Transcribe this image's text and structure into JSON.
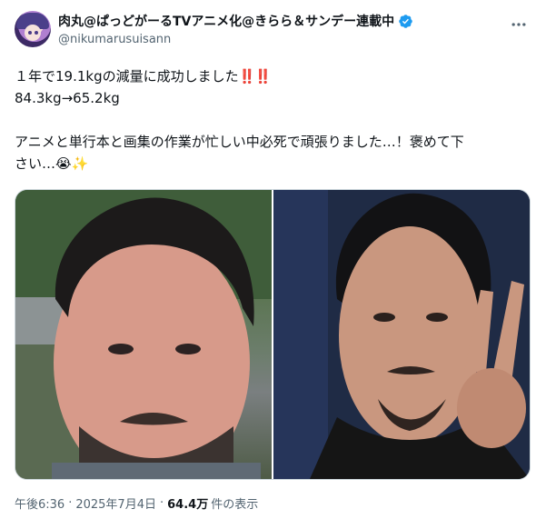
{
  "author": {
    "display_name": "肉丸@ぱっどがーるTVアニメ化@きらら＆サンデー連載中",
    "handle": "@nikumarusuisann",
    "verified_color": "#1d9bf0"
  },
  "tweet": {
    "line1": "１年で19.1kgの減量に成功しました",
    "line1_emoji": "‼️‼️",
    "line2": "84.3kg→65.2kg",
    "line3": "アニメと単行本と画集の作業が忙しい中必死で頑張りました…！褒めて下",
    "line4": "さい…",
    "line4_emoji": "😭✨"
  },
  "media": {
    "photos": [
      {
        "label": "before-photo"
      },
      {
        "label": "after-photo"
      }
    ]
  },
  "meta": {
    "time": "午後6:36",
    "separator": "·",
    "date": "2025年7月4日",
    "separator2": "·",
    "views": "64.4万",
    "views_label": "件の表示"
  },
  "icons": {
    "more": "more-horizontal-icon",
    "verified": "verified-badge-icon"
  }
}
